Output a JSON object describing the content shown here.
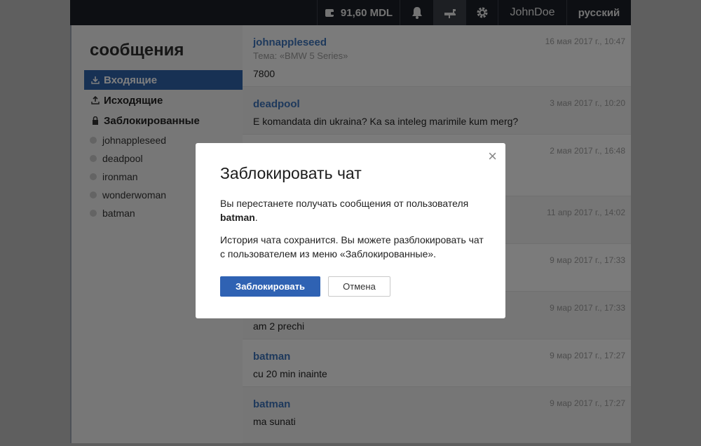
{
  "topbar": {
    "balance": "91,60 MDL",
    "user": "JohnDoe",
    "language": "русский"
  },
  "sidebar": {
    "title": "сообщения",
    "nav": [
      {
        "label": "Входящие",
        "active": true
      },
      {
        "label": "Исходящие",
        "active": false
      },
      {
        "label": "Заблокированные",
        "active": false
      }
    ],
    "contacts": [
      "johnappleseed",
      "deadpool",
      "ironman",
      "wonderwoman",
      "batman"
    ]
  },
  "messages": [
    {
      "sender": "johnappleseed",
      "date": "16 мая 2017 г., 10:47",
      "subject": "Тема: «BMW 5 Series»",
      "text": "7800"
    },
    {
      "sender": "deadpool",
      "date": "3 мая 2017 г., 10:20",
      "text": "E komandata din ukraina? Ka sa inteleg marimile kum merg?"
    },
    {
      "sender": "",
      "date": "2 мая 2017 г., 16:48",
      "text": ""
    },
    {
      "sender": "",
      "date": "11 апр 2017 г., 14:02",
      "text": ""
    },
    {
      "sender": "",
      "date": "9 мар 2017 г., 17:33",
      "text": ""
    },
    {
      "sender": "",
      "date": "9 мар 2017 г., 17:33",
      "text": "am 2 prechi"
    },
    {
      "sender": "batman",
      "date": "9 мар 2017 г., 17:27",
      "text": "cu 20 min inainte"
    },
    {
      "sender": "batman",
      "date": "9 мар 2017 г., 17:27",
      "text": "ma sunati"
    }
  ],
  "modal": {
    "title": "Заблокировать чат",
    "p1_text": "Вы перестанете получать сообщения от пользователя",
    "p1_user": "batman",
    "p1_end": ".",
    "p2": "История чата сохранится. Вы можете разблокировать чат с пользователем из меню «Заблокированные».",
    "confirm_label": "Заблокировать",
    "cancel_label": "Отмена",
    "close_glyph": "×"
  },
  "colors": {
    "accent": "#2f62a9",
    "topbar": "#1b1f27",
    "link": "#3d73b9"
  }
}
